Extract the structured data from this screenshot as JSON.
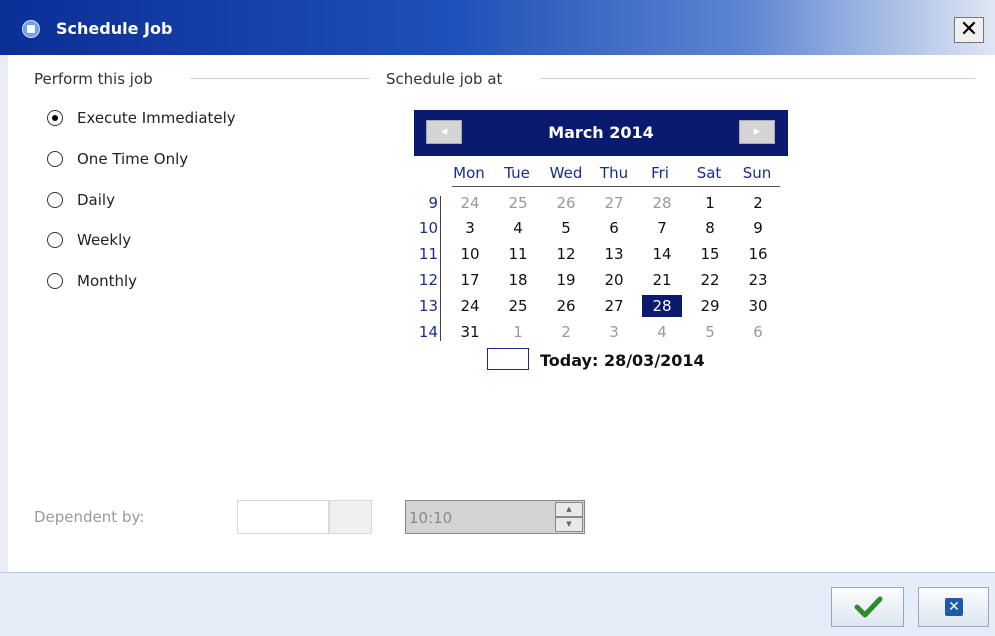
{
  "window": {
    "title": "Schedule Job",
    "close_glyph": "✕"
  },
  "left_section": {
    "label": "Perform this job",
    "options": [
      {
        "label": "Execute Immediately",
        "checked": true
      },
      {
        "label": "One Time Only",
        "checked": false
      },
      {
        "label": "Daily",
        "checked": false
      },
      {
        "label": "Weekly",
        "checked": false
      },
      {
        "label": "Monthly",
        "checked": false
      }
    ]
  },
  "right_section": {
    "label": "Schedule job at"
  },
  "calendar": {
    "month_label": "March 2014",
    "prev_glyph": "◂",
    "next_glyph": "▸",
    "weekdays": [
      "Mon",
      "Tue",
      "Wed",
      "Thu",
      "Fri",
      "Sat",
      "Sun"
    ],
    "weeks": [
      {
        "num": "9",
        "days": [
          "24",
          "25",
          "26",
          "27",
          "28",
          "1",
          "2"
        ]
      },
      {
        "num": "10",
        "days": [
          "3",
          "4",
          "5",
          "6",
          "7",
          "8",
          "9"
        ]
      },
      {
        "num": "11",
        "days": [
          "10",
          "11",
          "12",
          "13",
          "14",
          "15",
          "16"
        ]
      },
      {
        "num": "12",
        "days": [
          "17",
          "18",
          "19",
          "20",
          "21",
          "22",
          "23"
        ]
      },
      {
        "num": "13",
        "days": [
          "24",
          "25",
          "26",
          "27",
          "28",
          "29",
          "30"
        ]
      },
      {
        "num": "14",
        "days": [
          "31",
          "1",
          "2",
          "3",
          "4",
          "5",
          "6"
        ]
      }
    ],
    "selected_day": "28",
    "today_label": "Today: 28/03/2014",
    "accent_color": "#0a1a6e"
  },
  "dependency": {
    "label": "Dependent by:",
    "time_value": "10:10"
  },
  "footer": {
    "ok_icon": "checkmark-icon",
    "cancel_icon": "close-icon",
    "cancel_glyph": "✕"
  }
}
